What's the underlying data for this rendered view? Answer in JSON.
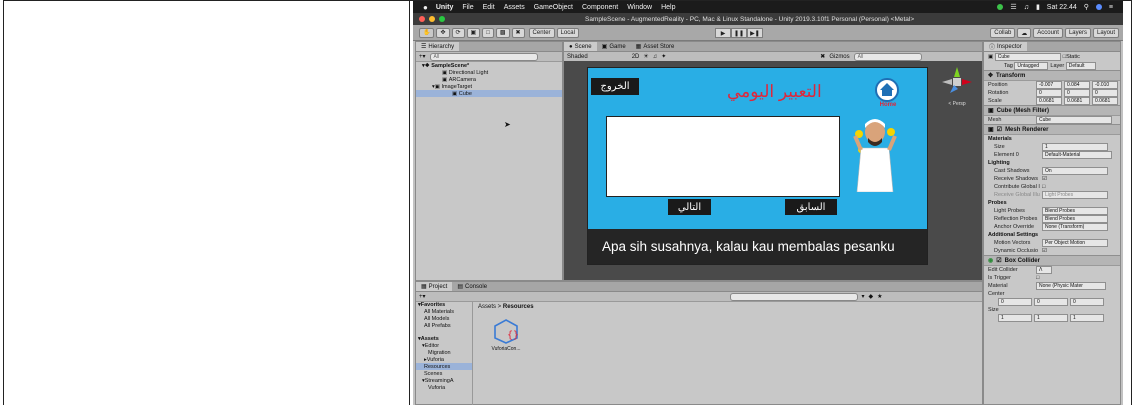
{
  "menubar": {
    "apple": "",
    "items": [
      "Unity",
      "File",
      "Edit",
      "Assets",
      "GameObject",
      "Component",
      "Window",
      "Help"
    ],
    "clock": "Sat 22.44"
  },
  "window": {
    "title": "SampleScene - AugmentedReality - PC, Mac & Linux Standalone - Unity 2019.3.10f1 Personal (Personal) <Metal>"
  },
  "toolbar": {
    "center": "Center",
    "local": "Local",
    "collab": "Collab",
    "account": "Account",
    "layers": "Layers",
    "layout": "Layout"
  },
  "hierarchy": {
    "tab": "Hierarchy",
    "search_placeholder": "All",
    "items": [
      {
        "label": "SampleScene*",
        "depth": 0
      },
      {
        "label": "Directional Light",
        "depth": 2
      },
      {
        "label": "ARCamera",
        "depth": 2
      },
      {
        "label": "ImageTarget",
        "depth": 1
      },
      {
        "label": "Cube",
        "depth": 2
      }
    ]
  },
  "scene": {
    "tabs": [
      "Scene",
      "Game",
      "Asset Store"
    ],
    "shading": "Shaded",
    "mode": "2D",
    "gizmos": "Gizmos",
    "search_placeholder": "All",
    "persp": "< Persp"
  },
  "game_canvas": {
    "exit_button": "الخروج",
    "title": "التعبير اليومي",
    "home_label": "Home",
    "next_button": "التالي",
    "prev_button": "السابق",
    "subtitle": "Apa sih susahnya, kalau kau membalas pesanku"
  },
  "project": {
    "tabs": [
      "Project",
      "Console"
    ],
    "breadcrumb": [
      "Assets",
      "Resources"
    ],
    "favorites": [
      "Favorites",
      "All Materials",
      "All Models",
      "All Prefabs"
    ],
    "assets_tree": [
      "Assets",
      "Editor",
      "Migration",
      "Vuforia",
      "Resources",
      "Scenes",
      "StreamingA",
      "Vuforia"
    ],
    "file_name": "VuforiaCon..."
  },
  "inspector": {
    "tab": "Inspector",
    "object_name": "Cube",
    "static_label": "Static",
    "tag_label": "Tag",
    "tag_value": "Untagged",
    "layer_label": "Layer",
    "layer_value": "Default",
    "transform": {
      "title": "Transform",
      "position": {
        "label": "Position",
        "x": "-0.007",
        "y": "0.084",
        "z": "-0.010"
      },
      "rotation": {
        "label": "Rotation",
        "x": "0",
        "y": "0",
        "z": "0"
      },
      "scale": {
        "label": "Scale",
        "x": "0.0681",
        "y": "0.0681",
        "z": "0.0681"
      }
    },
    "mesh_filter": {
      "title": "Cube (Mesh Filter)",
      "mesh_label": "Mesh",
      "mesh_value": "Cube"
    },
    "mesh_renderer": {
      "title": "Mesh Renderer",
      "materials": "Materials",
      "size_label": "Size",
      "size_value": "1",
      "element_label": "Element 0",
      "element_value": "Default-Material",
      "lighting": "Lighting",
      "cast_shadows_label": "Cast Shadows",
      "cast_shadows_value": "On",
      "receive_shadows": "Receive Shadows",
      "contribute_gi": "Contribute Global I",
      "receive_gi_label": "Receive Global Illu",
      "receive_gi_value": "Light Probes",
      "probes": "Probes",
      "light_probes_label": "Light Probes",
      "light_probes_value": "Blend Probes",
      "reflection_probes_label": "Reflection Probes",
      "reflection_probes_value": "Blend Probes",
      "anchor_override_label": "Anchor Override",
      "anchor_override_value": "None (Transform)",
      "additional": "Additional Settings",
      "motion_vectors_label": "Motion Vectors",
      "motion_vectors_value": "Per Object Motion",
      "dynamic_occlusion": "Dynamic Occlusio"
    },
    "box_collider": {
      "title": "Box Collider",
      "edit_collider": "Edit Collider",
      "is_trigger": "Is Trigger",
      "material_label": "Material",
      "material_value": "None (Physic Mater",
      "center": "Center",
      "center_x": "0",
      "center_y": "0",
      "center_z": "0",
      "size": "Size",
      "size_x": "1",
      "size_y": "1",
      "size_z": "1"
    }
  },
  "colors": {
    "canvas_blue": "#29aee5",
    "title_red": "#e0263a",
    "selection": "#9bb3d9"
  }
}
